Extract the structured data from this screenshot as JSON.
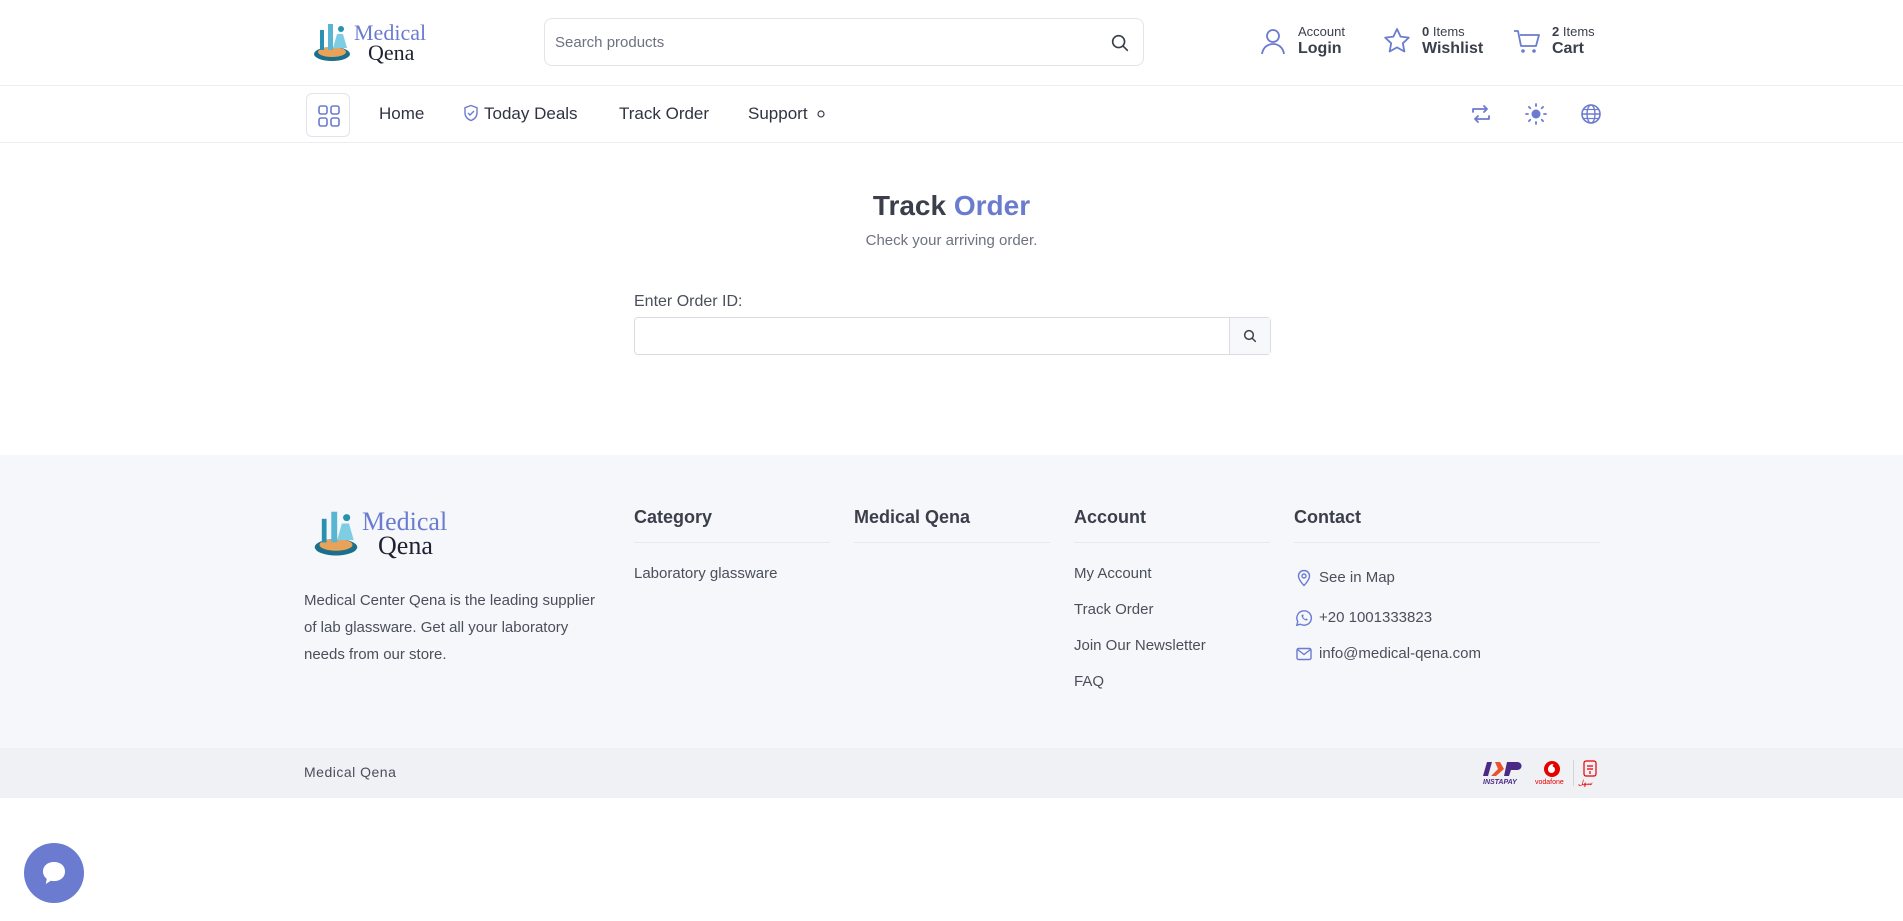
{
  "brand": {
    "line1": "Medical",
    "line2": "Qena"
  },
  "search": {
    "placeholder": "Search products"
  },
  "header": {
    "account": {
      "top": "Account",
      "bottom": "Login"
    },
    "wishlist": {
      "count": "0",
      "unit": "Items",
      "bottom": "Wishlist"
    },
    "cart": {
      "count": "2",
      "unit": "Items",
      "bottom": "Cart"
    }
  },
  "nav": {
    "items": [
      {
        "label": "Home"
      },
      {
        "label": "Today Deals"
      },
      {
        "label": "Track Order"
      },
      {
        "label": "Support"
      }
    ]
  },
  "main": {
    "title_part1": "Track",
    "title_part2": "Order",
    "subtitle": "Check your arriving order.",
    "order_label": "Enter Order ID:",
    "order_value": ""
  },
  "footer": {
    "description": "Medical Center Qena is the leading supplier of lab glassware. Get all your laboratory needs from our store.",
    "category": {
      "heading": "Category",
      "links": [
        "Laboratory glassware"
      ]
    },
    "medical": {
      "heading": "Medical Qena"
    },
    "account": {
      "heading": "Account",
      "links": [
        "My Account",
        "Track Order",
        "Join Our Newsletter",
        "FAQ"
      ]
    },
    "contact": {
      "heading": "Contact",
      "map": "See in Map",
      "phone": "+20 1001333823",
      "email": "info@medical-qena.com"
    },
    "copyright": "Medical Qena",
    "payments": {
      "instapay": "INSTAPAY",
      "vodafone": "vodafone",
      "third": "سهل"
    }
  },
  "colors": {
    "accent": "#6b7bd0",
    "text": "#3a3f4b",
    "footer_bg": "#f6f7fa"
  }
}
